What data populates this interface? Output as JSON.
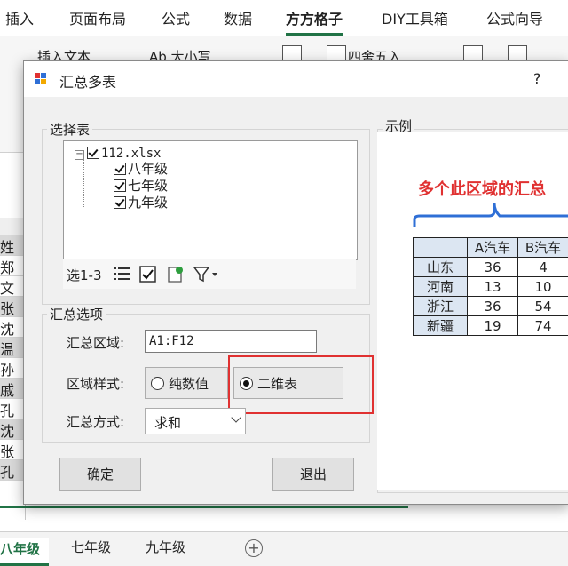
{
  "ribbon": {
    "tabs": [
      "插入",
      "页面布局",
      "公式",
      "数据",
      "方方格子",
      "DIY工具箱",
      "公式向导"
    ],
    "active_tab": "方方格子",
    "items": [
      "插入文本",
      "Ab 大小写",
      "四舍五入"
    ]
  },
  "sheet_cells": [
    "姓",
    "郑",
    "文",
    "张",
    "沈",
    "温",
    "孙",
    "戚",
    "孔",
    "沈",
    "张",
    "孔"
  ],
  "sheet_tabs": [
    "八年级",
    "七年级",
    "九年级"
  ],
  "dialog": {
    "title": "汇总多表",
    "help": "?",
    "select_group": "选择表",
    "tree": {
      "file": "112.xlsx",
      "sheets": [
        "八年级",
        "七年级",
        "九年级"
      ]
    },
    "toolbar_label": "选1-3",
    "options_group": "汇总选项",
    "range_label": "汇总区域:",
    "range_value": "A1:F12",
    "style_label": "区域样式:",
    "style_options": [
      "纯数值",
      "二维表"
    ],
    "style_selected": "二维表",
    "method_label": "汇总方式:",
    "method_value": "求和",
    "ok": "确定",
    "exit": "退出",
    "example_group": "示例",
    "example_text": "多个此区域的汇总",
    "example_table": {
      "headers": [
        "",
        "A汽车",
        "B汽车"
      ],
      "rows": [
        [
          "山东",
          "36",
          "4"
        ],
        [
          "河南",
          "13",
          "10"
        ],
        [
          "浙江",
          "36",
          "54"
        ],
        [
          "新疆",
          "19",
          "74"
        ]
      ]
    }
  },
  "colors": {
    "excel_green": "#217346",
    "highlight_red": "#e03131",
    "example_red": "#e03131"
  }
}
